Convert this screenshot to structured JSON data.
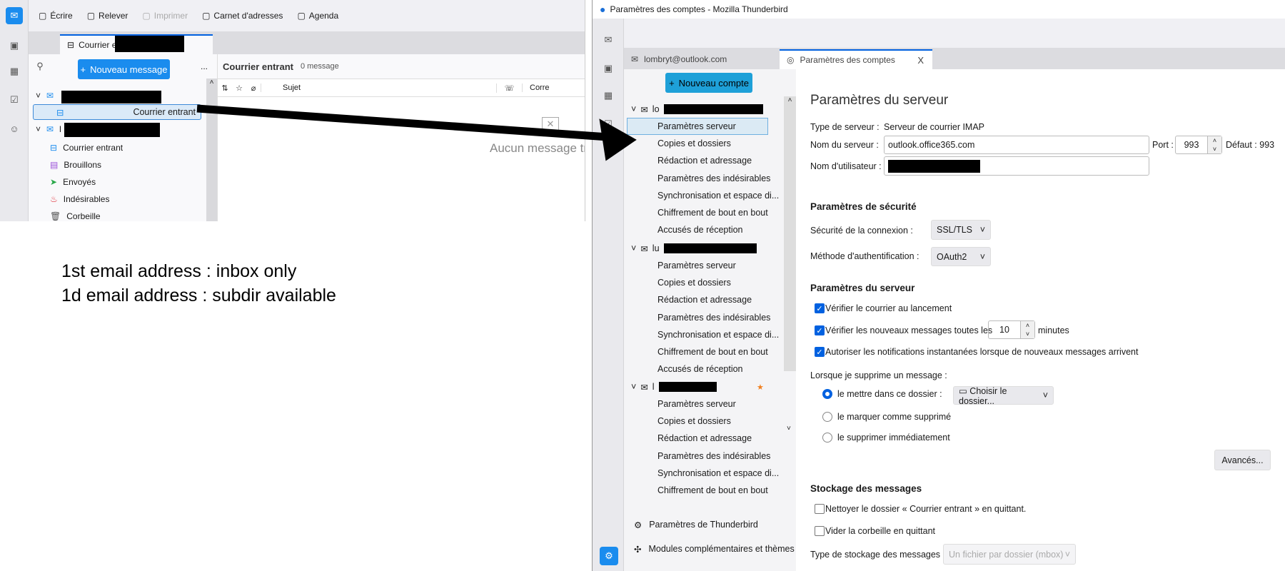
{
  "left_window": {
    "toolbar": [
      {
        "label": "Écrire",
        "icon": "compose-icon"
      },
      {
        "label": "Relever",
        "icon": "get-mail-icon"
      },
      {
        "label": "Imprimer",
        "icon": "print-icon",
        "disabled": true
      },
      {
        "label": "Carnet d'adresses",
        "icon": "address-book-icon"
      },
      {
        "label": "Agenda",
        "icon": "calendar-icon"
      }
    ],
    "tab_label": "Courrier entrant -",
    "new_message": "Nouveau message",
    "more": "...",
    "folders": [
      {
        "type": "account",
        "label": ""
      },
      {
        "type": "folder",
        "label": "Courrier entrant",
        "icon": "inbox-icon",
        "selected": true
      },
      {
        "type": "account",
        "label": "l"
      },
      {
        "type": "folder",
        "label": "Courrier entrant",
        "icon": "inbox-icon"
      },
      {
        "type": "folder",
        "label": "Brouillons",
        "icon": "drafts-icon"
      },
      {
        "type": "folder",
        "label": "Envoyés",
        "icon": "sent-icon"
      },
      {
        "type": "folder",
        "label": "Indésirables",
        "icon": "junk-icon"
      },
      {
        "type": "folder",
        "label": "Corbeille",
        "icon": "trash-icon"
      }
    ],
    "message_list": {
      "title": "Courrier entrant",
      "count": "0 message",
      "col_subject": "Sujet",
      "col_correspondent": "Corre",
      "empty": "Aucun message tr"
    }
  },
  "annotation": [
    "1st email address : inbox only",
    "1d email address : subdir available"
  ],
  "right_window": {
    "title": "Paramètres des comptes - Mozilla Thunderbird",
    "tabs": [
      {
        "label": "lombryt@outlook.com"
      },
      {
        "label": "Paramètres des comptes",
        "close": "X",
        "active": true
      }
    ],
    "new_account": "Nouveau compte",
    "accounts": [
      {
        "prefix": "lo",
        "items": [
          "Paramètres serveur",
          "Copies et dossiers",
          "Rédaction et adressage",
          "Paramètres des indésirables",
          "Synchronisation et espace di...",
          "Chiffrement de bout en bout",
          "Accusés de réception"
        ]
      },
      {
        "prefix": "lu",
        "items": [
          "Paramètres serveur",
          "Copies et dossiers",
          "Rédaction et adressage",
          "Paramètres des indésirables",
          "Synchronisation et espace di...",
          "Chiffrement de bout en bout",
          "Accusés de réception"
        ]
      },
      {
        "prefix": "l",
        "items": [
          "Paramètres serveur",
          "Copies et dossiers",
          "Rédaction et adressage",
          "Paramètres des indésirables",
          "Synchronisation et espace di...",
          "Chiffrement de bout en bout"
        ]
      }
    ],
    "bottom": [
      "Paramètres de Thunderbird",
      "Modules complémentaires et thèmes"
    ],
    "content": {
      "title": "Paramètres du serveur",
      "server_type_label": "Type de serveur :",
      "server_type": "Serveur de courrier IMAP",
      "server_name_label": "Nom du serveur :",
      "server_name": "outlook.office365.com",
      "port_label": "Port :",
      "port": "993",
      "default_label": "Défaut : 993",
      "username_label": "Nom d'utilisateur :",
      "security_heading": "Paramètres de sécurité",
      "conn_security_label": "Sécurité de la connexion :",
      "conn_security": "SSL/TLS",
      "auth_label": "Méthode d'authentification :",
      "auth": "OAuth2",
      "server_heading": "Paramètres du serveur",
      "check_startup": "Vérifier le courrier au lancement",
      "check_every": "Vérifier les nouveaux messages toutes les",
      "check_every_value": "10",
      "minutes": "minutes",
      "push": "Autoriser les notifications instantanées lorsque de nouveaux messages arrivent",
      "delete_label": "Lorsque je supprime un message :",
      "radio_move": "le mettre dans ce dossier :",
      "choose_folder": "Choisir le dossier...",
      "radio_mark": "le marquer comme supprimé",
      "radio_delete": "le supprimer immédiatement",
      "advanced": "Avancés...",
      "storage_heading": "Stockage des messages",
      "clean_inbox": "Nettoyer le dossier « Courrier entrant » en quittant.",
      "empty_trash": "Vider la corbeille en quittant",
      "storage_type_label": "Type de stockage des messages :",
      "storage_type": "Un fichier par dossier (mbox)"
    }
  }
}
